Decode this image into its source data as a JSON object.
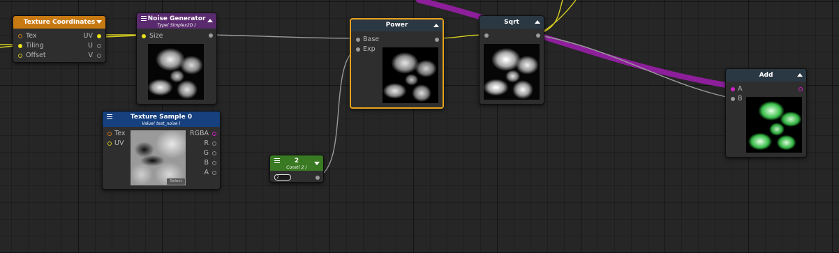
{
  "nodes": {
    "texture_coordinates": {
      "title": "Texture Coordinates",
      "inputs": [
        "Tex",
        "Tiling",
        "Offset"
      ],
      "outputs": [
        "UV",
        "U",
        "V"
      ],
      "color": "#c87a12"
    },
    "noise_generator": {
      "title": "Noise Generator",
      "subtitle": "Type( Simplex2D )",
      "inputs": [
        "Size"
      ],
      "color": "#5a2a6e"
    },
    "texture_sample": {
      "title": "Texture Sample 0",
      "subtitle": "Value( test_noise )",
      "inputs": [
        "Tex",
        "UV"
      ],
      "outputs": [
        "RGBA",
        "R",
        "G",
        "B",
        "A"
      ],
      "select_label": "Select",
      "color": "#16407e"
    },
    "const": {
      "title": "2",
      "subtitle": "Const( 2 )",
      "value": "2",
      "color": "#3a7a22"
    },
    "power": {
      "title": "Power",
      "inputs": [
        "Base",
        "Exp"
      ],
      "color": "#2a3844"
    },
    "sqrt": {
      "title": "Sqrt",
      "color": "#2a3844"
    },
    "add": {
      "title": "Add",
      "inputs": [
        "A",
        "B"
      ],
      "color": "#2a3844"
    }
  },
  "colors": {
    "wire_yellow": "#d6cf22",
    "wire_gray": "#9a9a9a",
    "wire_magenta": "#8d1f9a",
    "selection": "#e8a21c"
  }
}
